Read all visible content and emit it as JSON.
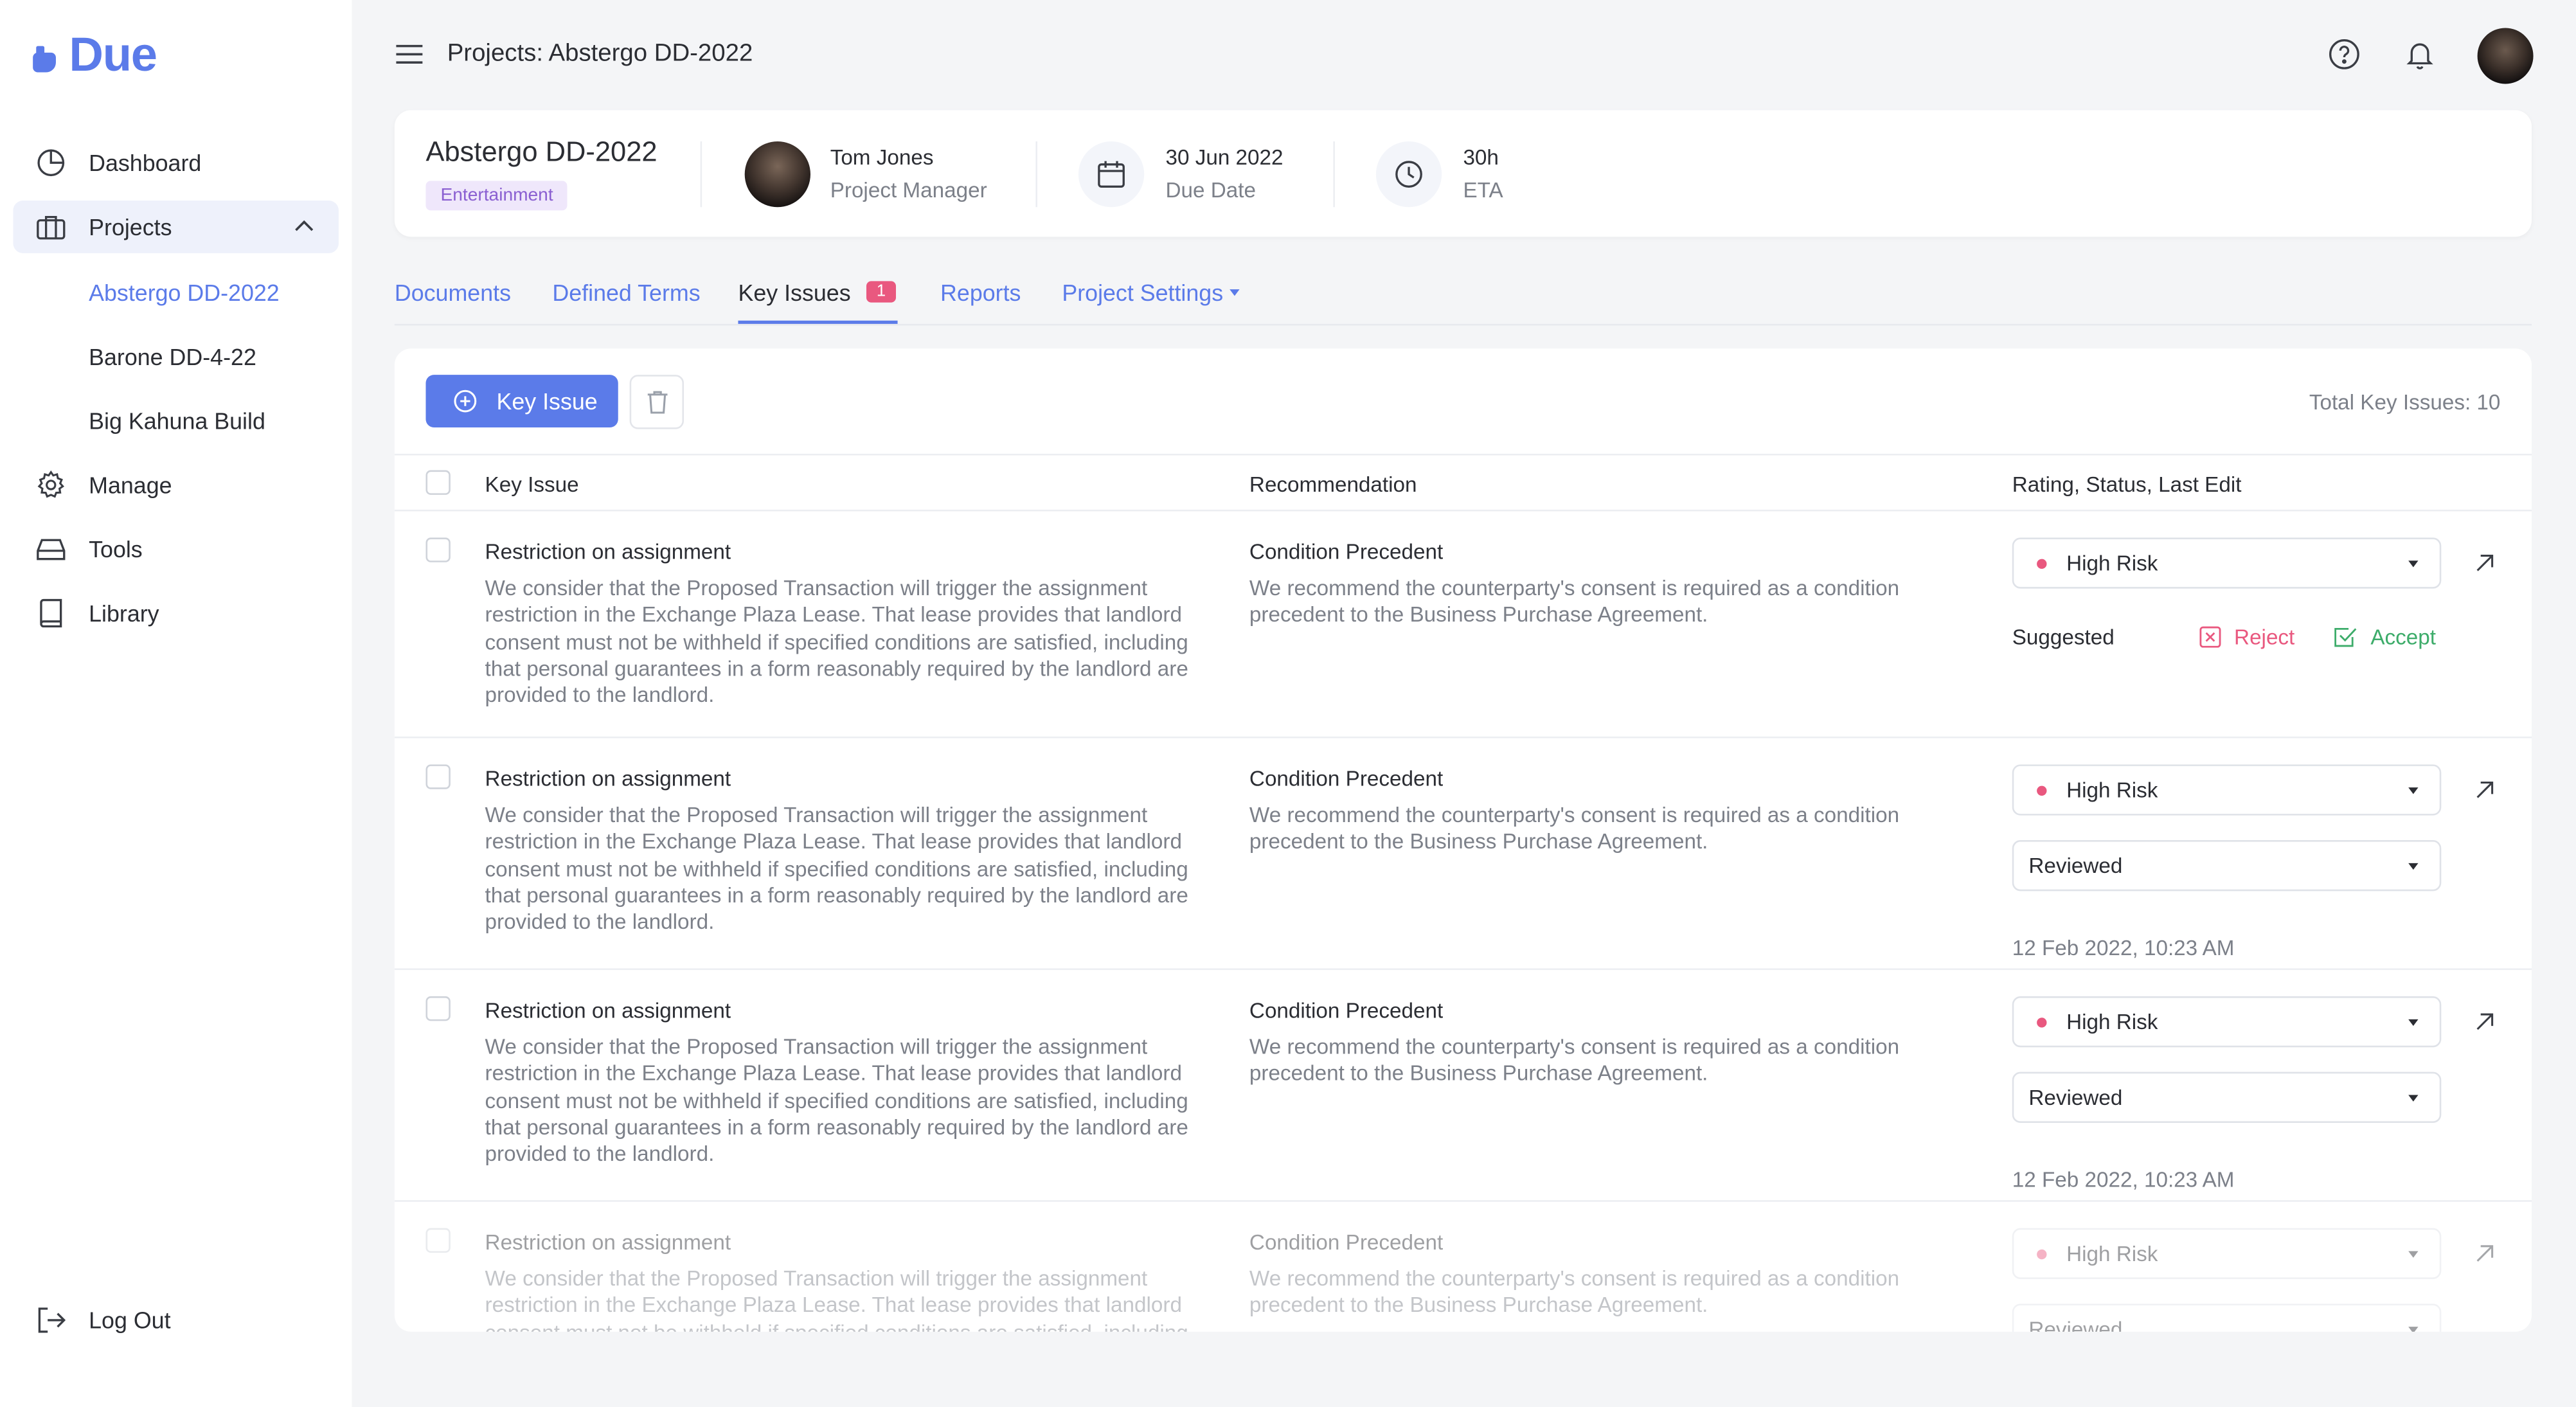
{
  "app": {
    "logo_text": "Due",
    "brand_color": "#5b7be9"
  },
  "sidebar": {
    "items": [
      {
        "label": "Dashboard",
        "icon": "pie-chart-icon"
      },
      {
        "label": "Projects",
        "icon": "briefcase-icon",
        "expanded": true
      },
      {
        "label": "Manage",
        "icon": "gear-icon"
      },
      {
        "label": "Tools",
        "icon": "inbox-tray-icon"
      },
      {
        "label": "Library",
        "icon": "book-icon"
      }
    ],
    "projects": [
      "Abstergo DD-2022",
      "Barone DD-4-22",
      "Big Kahuna Build"
    ],
    "logout": "Log Out"
  },
  "topbar": {
    "title": "Projects: Abstergo DD-2022",
    "icons": [
      "help-icon",
      "bell-icon",
      "user-avatar"
    ]
  },
  "project": {
    "name": "Abstergo DD-2022",
    "tag": "Entertainment",
    "manager_name": "Tom Jones",
    "manager_role": "Project Manager",
    "due_date": "30 Jun 2022",
    "due_label": "Due Date",
    "eta": "30h",
    "eta_label": "ETA"
  },
  "tabs": [
    {
      "label": "Documents"
    },
    {
      "label": "Defined Terms"
    },
    {
      "label": "Key Issues",
      "badge": "1",
      "active": true
    },
    {
      "label": "Reports"
    },
    {
      "label": "Project Settings",
      "dropdown": true
    }
  ],
  "toolbar": {
    "add_label": "Key Issue",
    "total_label": "Total Key Issues: 10"
  },
  "table": {
    "headers": [
      "Key Issue",
      "Recommendation",
      "Rating, Status, Last Edit"
    ],
    "rows": [
      {
        "title": "Restriction on assignment",
        "body": "We consider that the Proposed Transaction will trigger the assignment restriction in the Exchange Plaza Lease. That lease provides that landlord consent must not be withheld if specified conditions are satisfied, including that personal guarantees in a form reasonably required by the landlord are provided to the landlord.",
        "rec_title": "Condition Precedent",
        "rec_body": "We recommend the counterparty's consent is required as a condition precedent to the Business Purchase Agreement.",
        "rating": "High Risk",
        "suggested": "Suggested",
        "reject": "Reject",
        "accept": "Accept"
      },
      {
        "title": "Restriction on assignment",
        "body": "We consider that the Proposed Transaction will trigger the assignment restriction in the Exchange Plaza Lease. That lease provides that landlord consent must not be withheld if specified conditions are satisfied, including that personal guarantees in a form reasonably required by the landlord are provided to the landlord.",
        "rec_title": "Condition Precedent",
        "rec_body": "We recommend the counterparty's consent is required as a condition precedent to the Business Purchase Agreement.",
        "rating": "High Risk",
        "status": "Reviewed",
        "last_edit": "12 Feb 2022, 10:23 AM"
      },
      {
        "title": "Restriction on assignment",
        "body": "We consider that the Proposed Transaction will trigger the assignment restriction in the Exchange Plaza Lease. That lease provides that landlord consent must not be withheld if specified conditions are satisfied, including that personal guarantees in a form reasonably required by the landlord are provided to the landlord.",
        "rec_title": "Condition Precedent",
        "rec_body": "We recommend the counterparty's consent is required as a condition precedent to the Business Purchase Agreement.",
        "rating": "High Risk",
        "status": "Reviewed",
        "last_edit": "12 Feb 2022, 10:23 AM"
      },
      {
        "title": "Restriction on assignment",
        "body": "We consider that the Proposed Transaction will trigger the assignment restriction in the Exchange Plaza Lease. That lease provides that landlord consent must not be withheld if specified conditions are satisfied, including",
        "rec_title": "Condition Precedent",
        "rec_body": "We recommend the counterparty's consent is required as a condition precedent to the Business Purchase Agreement.",
        "rating": "High Risk",
        "status": "Reviewed"
      }
    ]
  },
  "colors": {
    "risk": "#e9587f",
    "accept": "#3dac6a",
    "tag_bg": "#efe7fb",
    "tag_text": "#8a5fd1"
  }
}
